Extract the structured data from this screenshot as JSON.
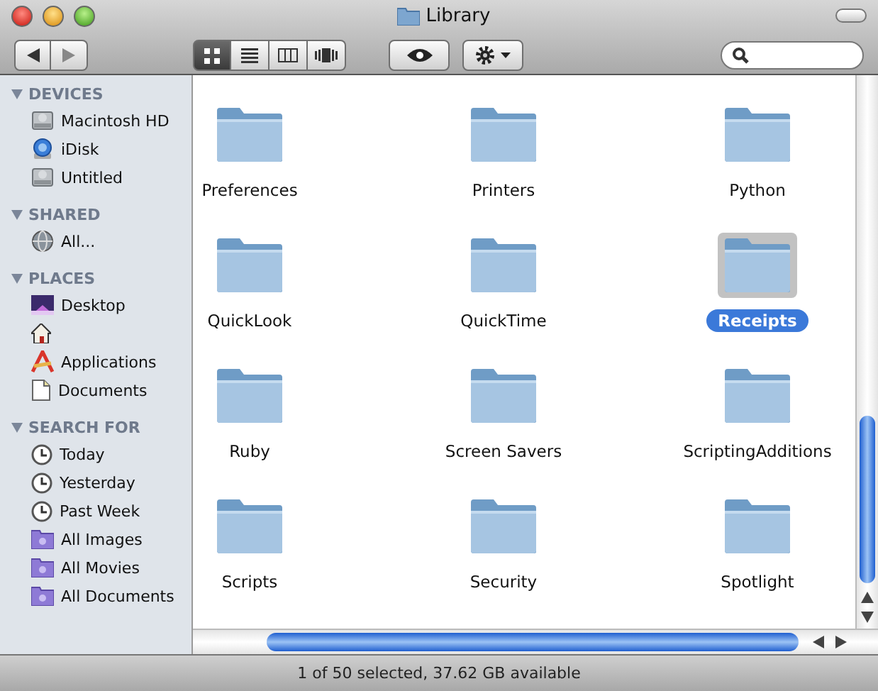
{
  "window": {
    "title": "Library"
  },
  "toolbar": {
    "view_modes": [
      {
        "kind": "icons",
        "selected": true
      },
      {
        "kind": "list",
        "selected": false
      },
      {
        "kind": "columns",
        "selected": false
      },
      {
        "kind": "coverflow",
        "selected": false
      }
    ]
  },
  "sidebar": {
    "groups": [
      {
        "title": "DEVICES",
        "expanded": true,
        "items": [
          {
            "kind": "disk",
            "label": "Macintosh HD"
          },
          {
            "kind": "idisk",
            "label": "iDisk"
          },
          {
            "kind": "disk",
            "label": "Untitled"
          }
        ]
      },
      {
        "title": "SHARED",
        "expanded": true,
        "items": [
          {
            "kind": "network",
            "label": "All..."
          }
        ]
      },
      {
        "title": "PLACES",
        "expanded": true,
        "items": [
          {
            "kind": "desktop",
            "label": "Desktop"
          },
          {
            "kind": "home"
          },
          {
            "kind": "apps",
            "label": "Applications"
          },
          {
            "kind": "document",
            "label": "Documents"
          }
        ]
      },
      {
        "title": "SEARCH FOR",
        "expanded": true,
        "items": [
          {
            "kind": "clock",
            "label": "Today"
          },
          {
            "kind": "clock",
            "label": "Yesterday"
          },
          {
            "kind": "clock",
            "label": "Past Week"
          },
          {
            "kind": "smart",
            "label": "All Images"
          },
          {
            "kind": "smart",
            "label": "All Movies"
          },
          {
            "kind": "smart",
            "label": "All Documents"
          }
        ]
      }
    ]
  },
  "files": [
    {
      "name": "Preferences",
      "selected": false
    },
    {
      "name": "Printers",
      "selected": false
    },
    {
      "name": "Python",
      "selected": false
    },
    {
      "name": "QuickLook",
      "selected": false
    },
    {
      "name": "QuickTime",
      "selected": false
    },
    {
      "name": "Receipts",
      "selected": true
    },
    {
      "name": "Ruby",
      "selected": false
    },
    {
      "name": "Screen Savers",
      "selected": false
    },
    {
      "name": "ScriptingAdditions",
      "selected": false
    },
    {
      "name": "Scripts",
      "selected": false
    },
    {
      "name": "Security",
      "selected": false
    },
    {
      "name": "Spotlight",
      "selected": false
    }
  ],
  "status_bar": "1 of 50 selected, 37.62 GB available"
}
